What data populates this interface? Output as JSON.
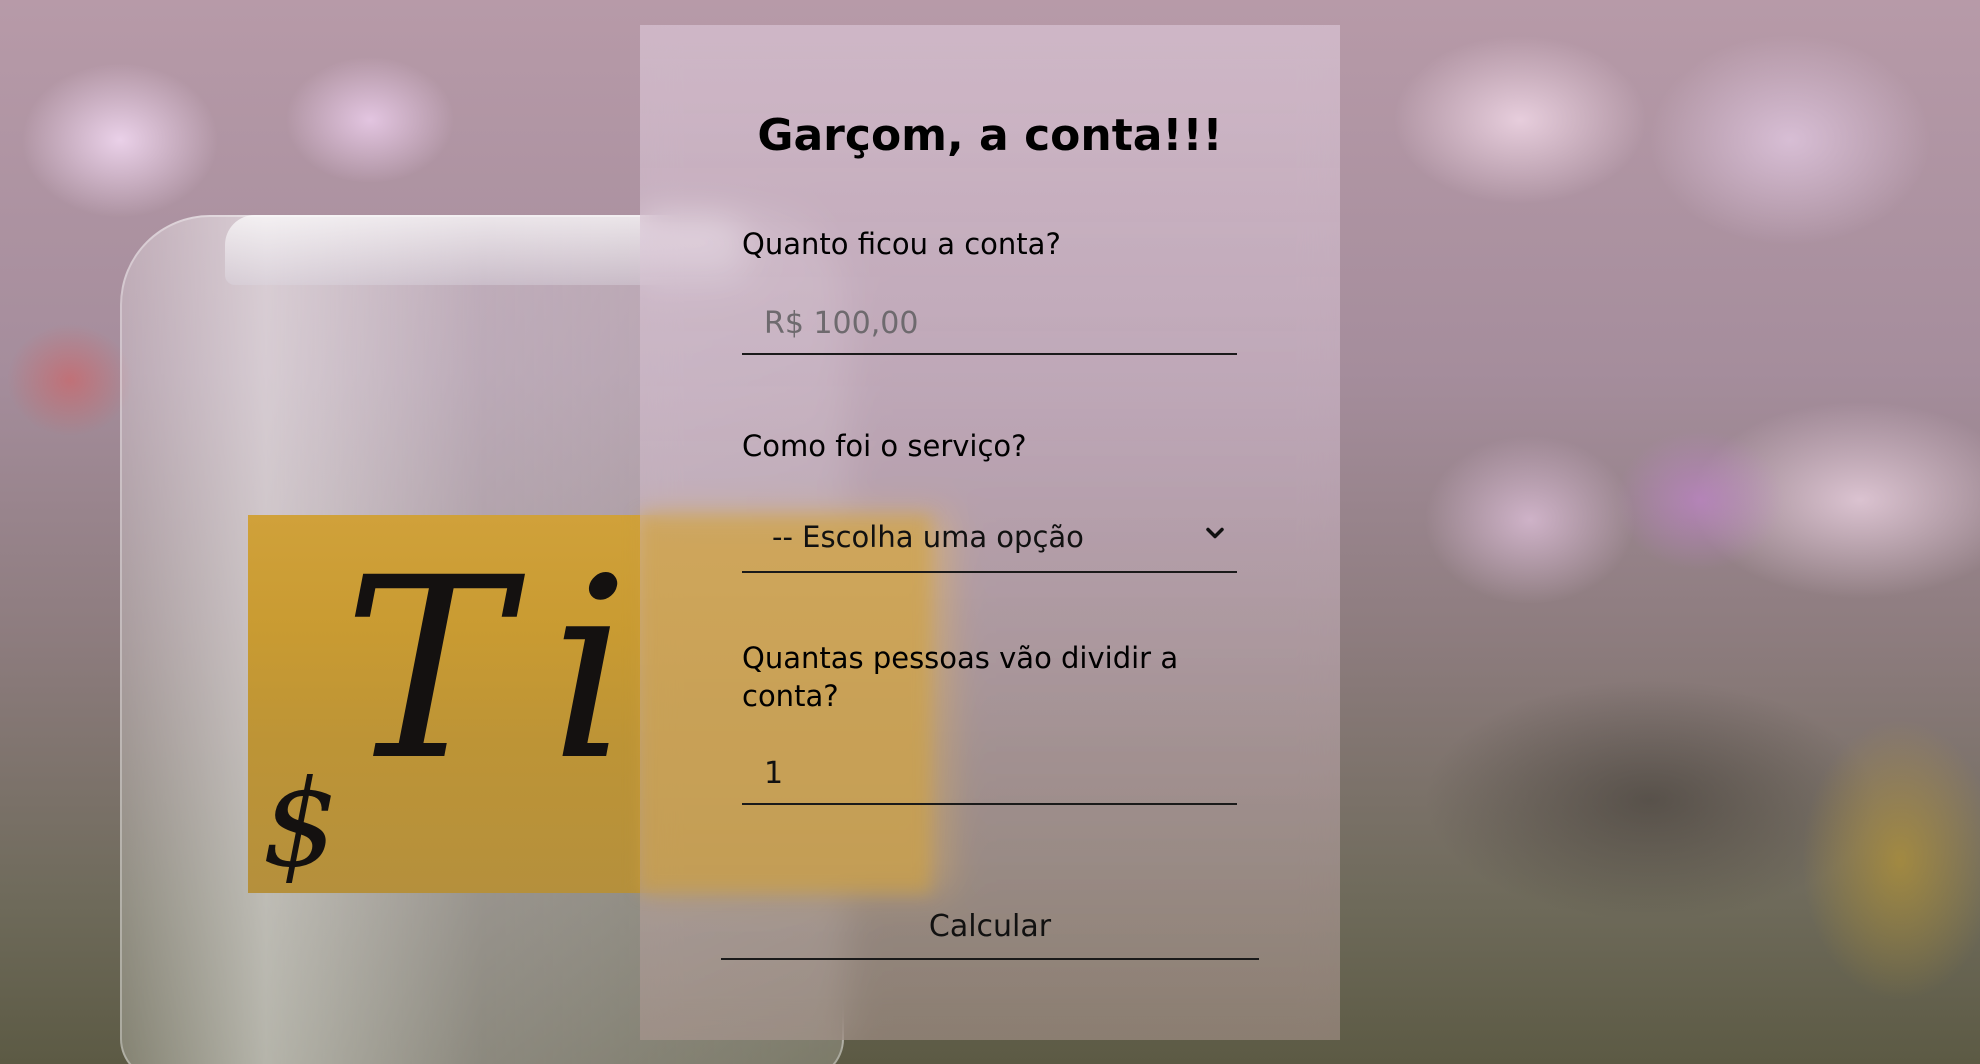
{
  "page": {
    "title": "Garçom, a conta!!!"
  },
  "form": {
    "bill": {
      "label": "Quanto ficou a conta?",
      "placeholder": "R$ 100,00",
      "value": ""
    },
    "service": {
      "label": "Como foi o serviço?",
      "selected": "-- Escolha uma opção"
    },
    "people": {
      "label": "Quantas pessoas vão dividir a conta?",
      "value": "1"
    },
    "submit_label": "Calcular"
  },
  "background": {
    "jar_label_text": "Ti",
    "jar_label_symbol": "$"
  },
  "icons": {
    "select_arrow": "chevron-down-icon"
  },
  "colors": {
    "text": "#000000",
    "underline": "#1a1a1a",
    "placeholder": "#6e6a6e"
  }
}
